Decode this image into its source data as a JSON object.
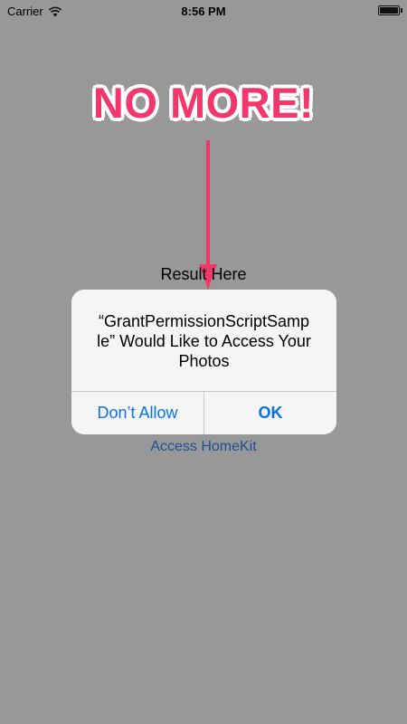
{
  "status_bar": {
    "carrier": "Carrier",
    "time": "8:56 PM",
    "battery_level": 1.0
  },
  "annotation": {
    "headline": "NO MORE!",
    "color": "#f2376c"
  },
  "screen": {
    "result_label": "Result Here",
    "homekit_link": "Access HomeKit"
  },
  "alert": {
    "title": "“GrantPermissionScriptSample” Would Like to Access Your Photos",
    "title_lines": [
      "“GrantPermissionScriptSamp",
      "le” Would Like to Access Your",
      "Photos"
    ],
    "deny_label": "Don’t Allow",
    "ok_label": "OK",
    "button_color": "#0a72e8"
  },
  "icons": {
    "wifi": "wifi-icon",
    "battery": "battery-icon",
    "arrow": "down-arrow-icon"
  }
}
